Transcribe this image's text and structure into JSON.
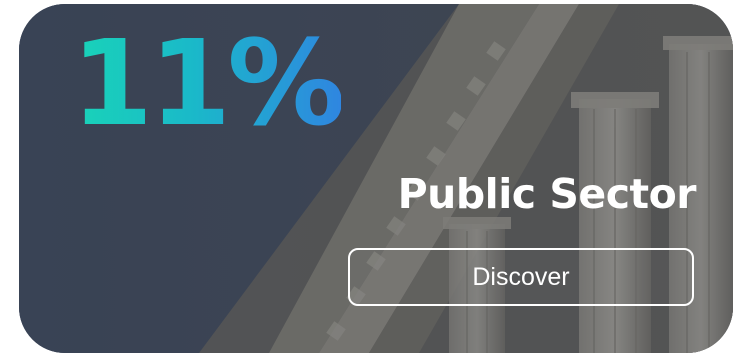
{
  "card": {
    "stat_value": "11%",
    "title": "Public Sector",
    "cta_label": "Discover",
    "background_image": "government-building-columns",
    "colors": {
      "card_bg": "#3f4a5e",
      "stat_gradient_start": "#19d4b8",
      "stat_gradient_end": "#2f86e0",
      "text": "#ffffff"
    }
  }
}
